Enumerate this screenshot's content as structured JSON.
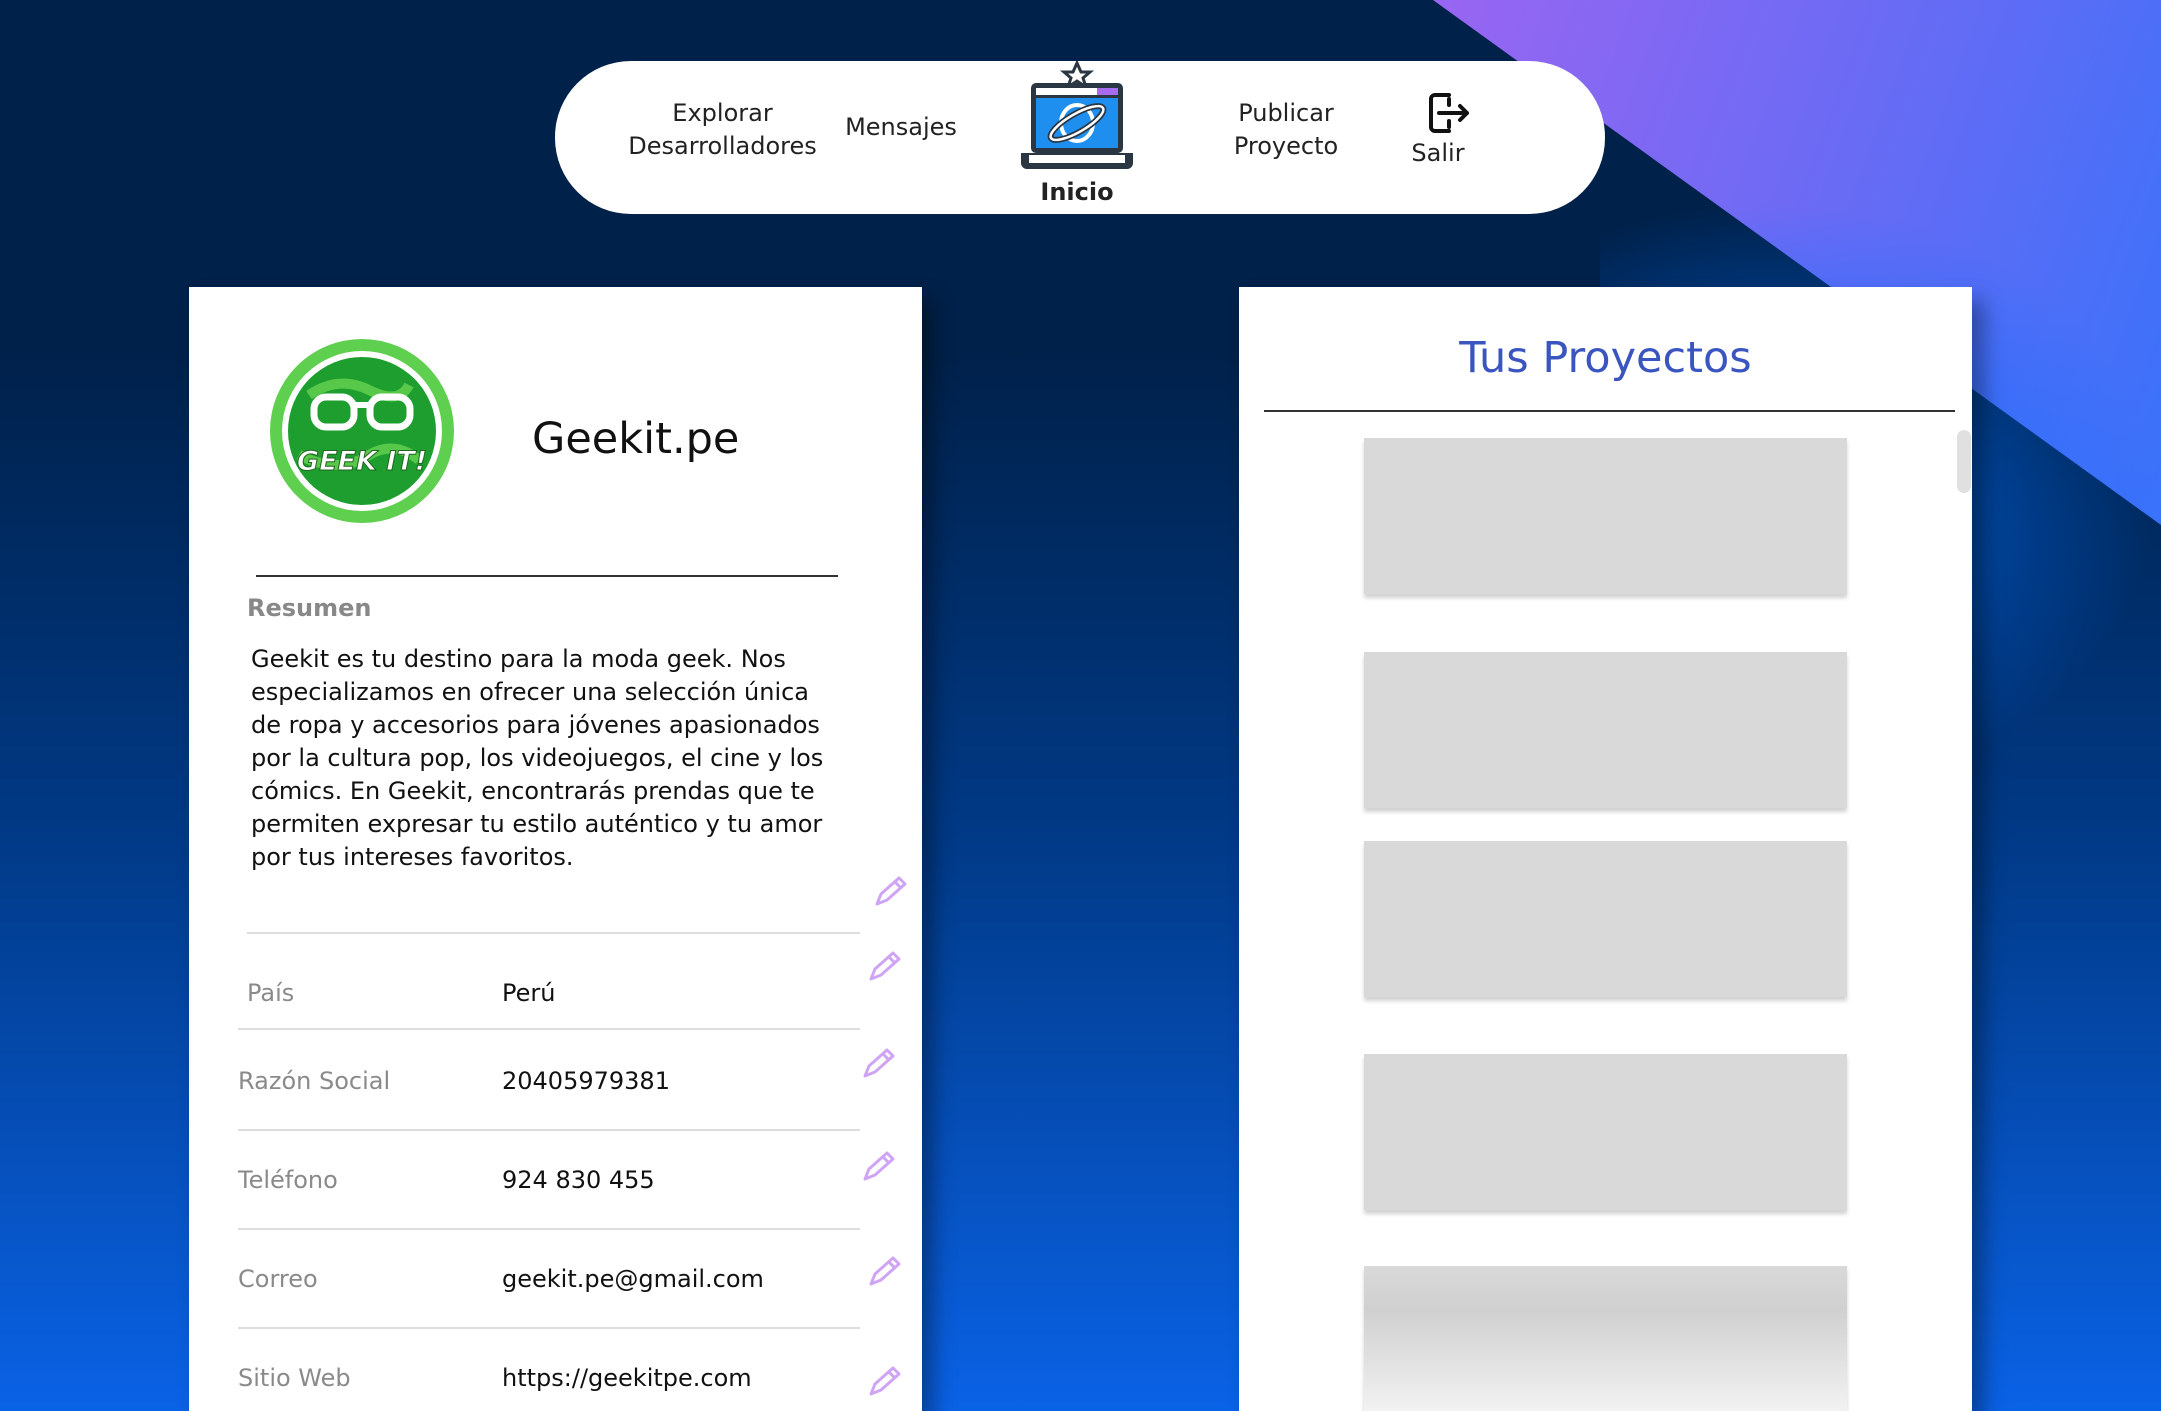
{
  "nav": {
    "explore": "Explorar Desarrolladores",
    "explore_l1": "Explorar",
    "explore_l2": "Desarrolladores",
    "messages": "Mensajes",
    "home": "Inicio",
    "publish_l1": "Publicar",
    "publish_l2": "Proyecto",
    "logout": "Salir"
  },
  "profile": {
    "logo_text": "GEEK IT!",
    "name": "Geekit.pe",
    "summary_label": "Resumen",
    "summary": "Geekit es tu destino para la moda geek. Nos especializamos en ofrecer una selección única de ropa y accesorios para jóvenes apasionados por la cultura pop, los videojuegos, el cine y los cómics. En Geekit, encontrarás prendas que te permiten expresar tu estilo auténtico y tu amor por tus intereses favoritos.",
    "fields": [
      {
        "label": "País",
        "value": "Perú"
      },
      {
        "label": "Razón Social",
        "value": "20405979381"
      },
      {
        "label": "Teléfono",
        "value": "924 830 455"
      },
      {
        "label": "Correo",
        "value": "geekit.pe@gmail.com"
      },
      {
        "label": "Sitio Web",
        "value": "https://geekitpe.com"
      }
    ]
  },
  "projects": {
    "title": "Tus Proyectos",
    "placeholder_count": 5
  },
  "colors": {
    "background": "#00214a",
    "accent_purple": "#b063f0",
    "title_blue": "#3b55c0",
    "pencil": "#d0a4f5"
  }
}
